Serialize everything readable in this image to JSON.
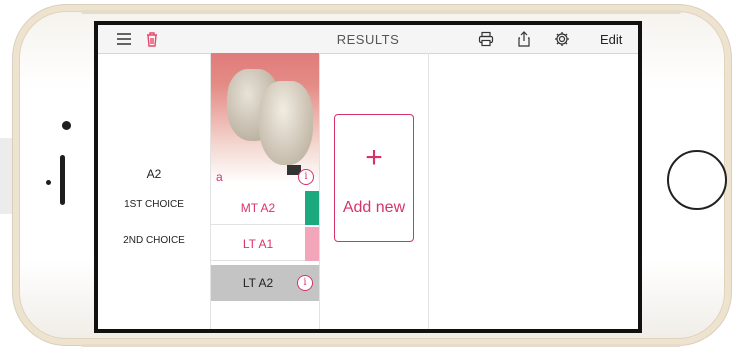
{
  "header": {
    "title": "RESULTS",
    "edit_label": "Edit",
    "icons": [
      "menu-icon",
      "trash-icon",
      "print-icon",
      "share-icon",
      "gear-icon"
    ]
  },
  "reference": {
    "shade": "A2"
  },
  "photo": {
    "label": "a",
    "info": "i"
  },
  "choices": [
    {
      "label": "1ST CHOICE",
      "shade": "MT A2",
      "swatch_color": "#1aaa7e"
    },
    {
      "label": "2ND CHOICE",
      "shade": "LT A1",
      "swatch_color": "#f3a6b9"
    },
    {
      "label": "",
      "shade": "LT A2",
      "info": "i"
    }
  ],
  "add_card": {
    "plus": "+",
    "label": "Add new"
  },
  "colors": {
    "accent": "#d6336c",
    "trash": "#e8496a",
    "choice_highlight": "#c4c4c4"
  }
}
